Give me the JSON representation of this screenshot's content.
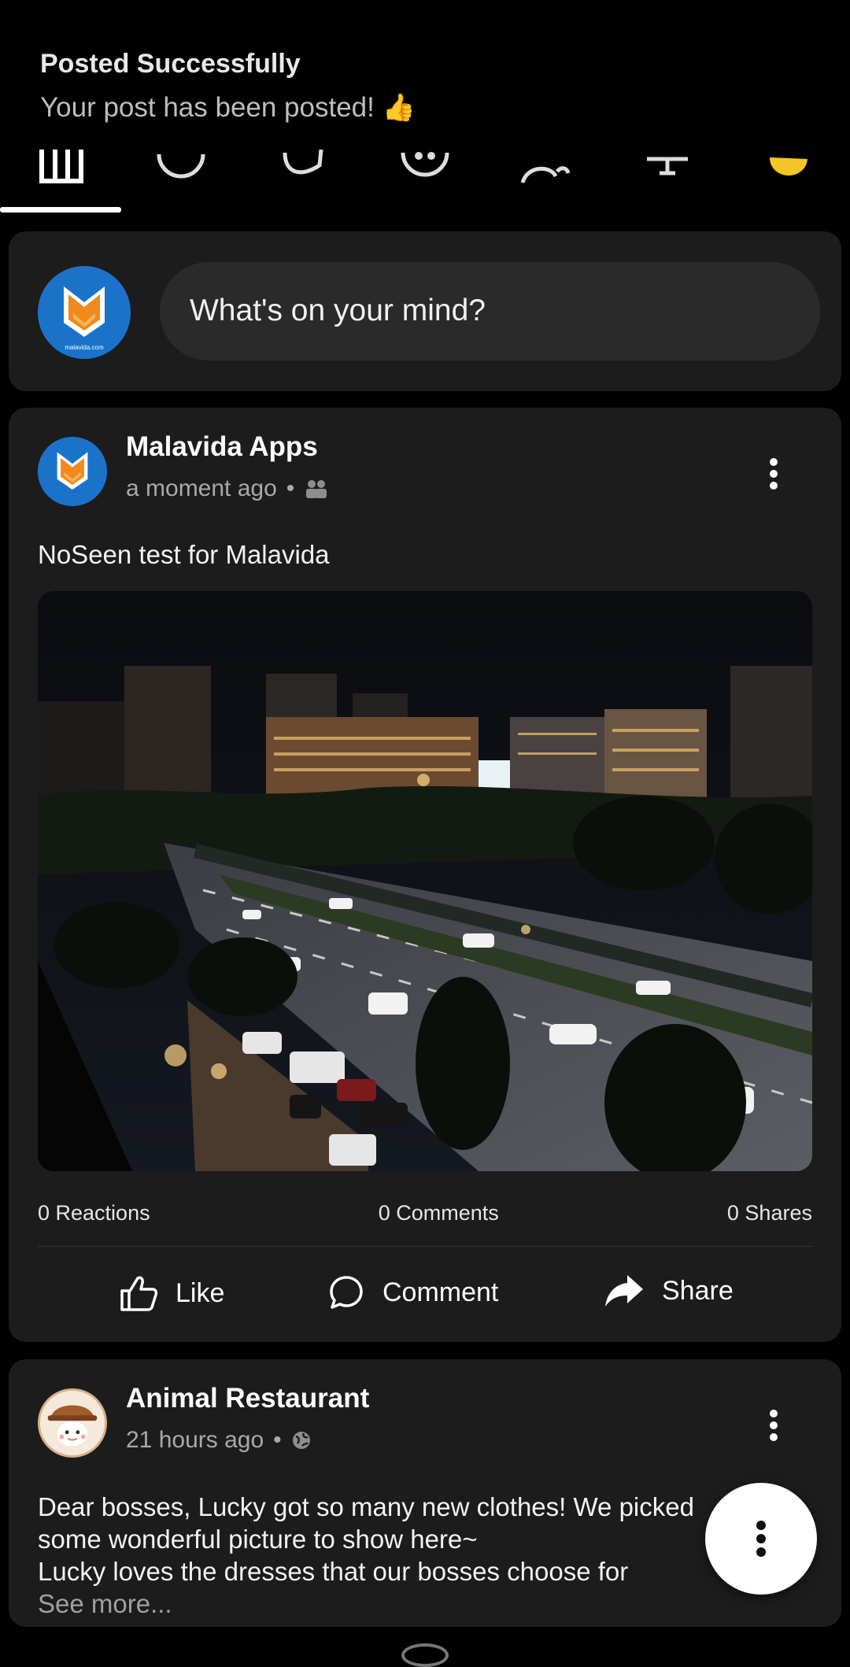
{
  "notification": {
    "title": "Posted Successfully",
    "message": "Your post has been posted!",
    "emoji": "👍"
  },
  "tabs": [
    "feed-icon",
    "marketplace-icon",
    "messenger-icon",
    "groups-icon",
    "watch-icon",
    "notifications-icon",
    "menu-icon"
  ],
  "composer": {
    "placeholder": "What's on your mind?",
    "avatar_caption": "malavida.com"
  },
  "post1": {
    "author": "Malavida Apps",
    "time": "a moment ago",
    "audience_icon": "friends-icon",
    "text": "NoSeen test for Malavida",
    "photo_alt": "Night city avenue with traffic",
    "reactions": "0 Reactions",
    "comments": "0 Comments",
    "shares": "0 Shares",
    "like_label": "Like",
    "comment_label": "Comment",
    "share_label": "Share"
  },
  "post2": {
    "author": "Animal Restaurant",
    "time": "21 hours ago",
    "audience_icon": "globe-icon",
    "line1": "Dear bosses, Lucky got so many new clothes! We picked",
    "line2": "some wonderful picture to show here~",
    "line3": "Lucky loves the dresses that our bosses choose for",
    "see_more": "See more..."
  },
  "fab_icon": "more-vertical-icon"
}
